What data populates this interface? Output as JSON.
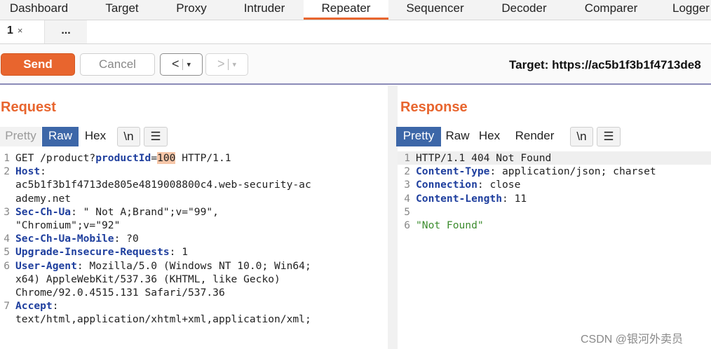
{
  "tabs": [
    "Dashboard",
    "Target",
    "Proxy",
    "Intruder",
    "Repeater",
    "Sequencer",
    "Decoder",
    "Comparer",
    "Logger"
  ],
  "subtabs": {
    "first": "1",
    "close": "×",
    "second": "..."
  },
  "toolbar": {
    "send": "Send",
    "cancel": "Cancel",
    "back_arrow": "<",
    "fwd_arrow": ">",
    "dropdown": "▾",
    "target": "Target: https://ac5b1f3b1f4713de8"
  },
  "request": {
    "title": "Request",
    "view_buttons": [
      "Pretty",
      "Raw",
      "Hex",
      "\\n",
      "☰"
    ],
    "lines": [
      {
        "n": "1",
        "parts": [
          {
            "t": "GET /product?",
            "c": ""
          },
          {
            "t": "productId",
            "c": "pk"
          },
          {
            "t": "=",
            "c": ""
          },
          {
            "t": "100",
            "c": "hl"
          },
          {
            "t": " HTTP/1.1",
            "c": ""
          }
        ]
      },
      {
        "n": "2",
        "parts": [
          {
            "t": "Host",
            "c": "hk"
          },
          {
            "t": ":",
            "c": ""
          }
        ]
      },
      {
        "n": "",
        "parts": [
          {
            "t": "ac5b1f3b1f4713de805e4819008800c4.web-security-ac",
            "c": ""
          }
        ]
      },
      {
        "n": "",
        "parts": [
          {
            "t": "ademy.net",
            "c": ""
          }
        ]
      },
      {
        "n": "3",
        "parts": [
          {
            "t": "Sec-Ch-Ua",
            "c": "hk"
          },
          {
            "t": ": \" Not A;Brand\";v=\"99\",",
            "c": ""
          }
        ]
      },
      {
        "n": "",
        "parts": [
          {
            "t": "\"Chromium\";v=\"92\"",
            "c": ""
          }
        ]
      },
      {
        "n": "4",
        "parts": [
          {
            "t": "Sec-Ch-Ua-Mobile",
            "c": "hk"
          },
          {
            "t": ": ?0",
            "c": ""
          }
        ]
      },
      {
        "n": "5",
        "parts": [
          {
            "t": "Upgrade-Insecure-Requests",
            "c": "hk"
          },
          {
            "t": ": 1",
            "c": ""
          }
        ]
      },
      {
        "n": "6",
        "parts": [
          {
            "t": "User-Agent",
            "c": "hk"
          },
          {
            "t": ": Mozilla/5.0 (Windows NT 10.0; Win64;",
            "c": ""
          }
        ]
      },
      {
        "n": "",
        "parts": [
          {
            "t": " x64) AppleWebKit/537.36 (KHTML, like Gecko)",
            "c": ""
          }
        ]
      },
      {
        "n": "",
        "parts": [
          {
            "t": "Chrome/92.0.4515.131 Safari/537.36",
            "c": ""
          }
        ]
      },
      {
        "n": "7",
        "parts": [
          {
            "t": "Accept",
            "c": "hk"
          },
          {
            "t": ":",
            "c": ""
          }
        ]
      },
      {
        "n": "",
        "parts": [
          {
            "t": "text/html,application/xhtml+xml,application/xml;",
            "c": ""
          }
        ]
      }
    ]
  },
  "response": {
    "title": "Response",
    "view_buttons": [
      "Pretty",
      "Raw",
      "Hex",
      "Render",
      "\\n",
      "☰"
    ],
    "lines": [
      {
        "n": "1",
        "parts": [
          {
            "t": "HTTP/1.1 404 Not Found",
            "c": ""
          }
        ]
      },
      {
        "n": "2",
        "parts": [
          {
            "t": "Content-Type",
            "c": "hk"
          },
          {
            "t": ": application/json; charset",
            "c": ""
          }
        ]
      },
      {
        "n": "3",
        "parts": [
          {
            "t": "Connection",
            "c": "hk"
          },
          {
            "t": ": close",
            "c": ""
          }
        ]
      },
      {
        "n": "4",
        "parts": [
          {
            "t": "Content-Length",
            "c": "hk"
          },
          {
            "t": ": 11",
            "c": ""
          }
        ]
      },
      {
        "n": "5",
        "parts": [
          {
            "t": "",
            "c": ""
          }
        ]
      },
      {
        "n": "6",
        "parts": [
          {
            "t": "\"Not Found\"",
            "c": "str"
          }
        ]
      }
    ]
  },
  "watermark": "CSDN @银河外卖员",
  "colors": {
    "accent": "#e8652e",
    "selected_view": "#3d67a8",
    "header_key": "#1f3f9e",
    "string": "#3c8c2e"
  }
}
